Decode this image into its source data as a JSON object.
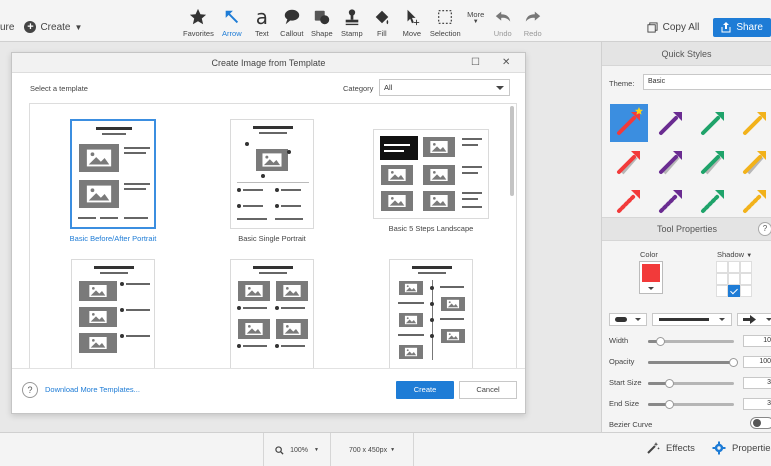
{
  "toolbar": {
    "capture_label": "ure",
    "create_label": "Create",
    "tools": [
      {
        "label": "Favorites",
        "icon": "star-icon",
        "state": "normal"
      },
      {
        "label": "Arrow",
        "icon": "arrow-icon",
        "state": "active"
      },
      {
        "label": "Text",
        "icon": "text-icon",
        "state": "normal"
      },
      {
        "label": "Callout",
        "icon": "callout-icon",
        "state": "normal"
      },
      {
        "label": "Shape",
        "icon": "shape-icon",
        "state": "normal"
      },
      {
        "label": "Stamp",
        "icon": "stamp-icon",
        "state": "normal"
      },
      {
        "label": "Fill",
        "icon": "fill-icon",
        "state": "normal"
      },
      {
        "label": "Move",
        "icon": "move-icon",
        "state": "normal"
      },
      {
        "label": "Selection",
        "icon": "selection-icon",
        "state": "normal"
      },
      {
        "label": "More",
        "icon": "more-icon",
        "state": "normal"
      },
      {
        "label": "Undo",
        "icon": "undo-icon",
        "state": "disabled"
      },
      {
        "label": "Redo",
        "icon": "redo-icon",
        "state": "disabled"
      }
    ],
    "text_glyph": "a",
    "copy_all_label": "Copy All",
    "share_label": "Share"
  },
  "dialog": {
    "title": "Create Image from Template",
    "select_label": "Select a template",
    "category_label": "Category",
    "category_value": "All",
    "templates": [
      {
        "name": "Basic Before/After Portrait",
        "selected": true
      },
      {
        "name": "Basic Single Portrait",
        "selected": false
      },
      {
        "name": "Basic 5 Steps Landscape",
        "selected": false
      },
      {
        "name": "",
        "selected": false
      },
      {
        "name": "",
        "selected": false
      },
      {
        "name": "",
        "selected": false
      }
    ],
    "help_glyph": "?",
    "download_link": "Download More Templates...",
    "create_button": "Create",
    "cancel_button": "Cancel"
  },
  "panel": {
    "quick_styles_title": "Quick Styles",
    "theme_label": "Theme:",
    "theme_value": "Basic",
    "arrow_colors": [
      "#f23a3a",
      "#6a2c91",
      "#1fa36a",
      "#f2b21b"
    ],
    "tool_properties_title": "Tool Properties",
    "help_glyph": "?",
    "color_label": "Color",
    "shadow_label": "Shadow",
    "current_color": "#f23a3a",
    "properties": [
      {
        "label": "Width",
        "value": "10",
        "level": 0.15
      },
      {
        "label": "Opacity",
        "value": "100",
        "level": 1.0
      },
      {
        "label": "Start Size",
        "value": "3",
        "level": 0.25
      },
      {
        "label": "End Size",
        "value": "3",
        "level": 0.25
      }
    ],
    "bezier_label": "Bezier Curve"
  },
  "status": {
    "zoom": "100%",
    "size": "700 x 450px",
    "effects_label": "Effects",
    "properties_label": "Properties"
  },
  "colors": {
    "accent": "#1e7cd6"
  }
}
